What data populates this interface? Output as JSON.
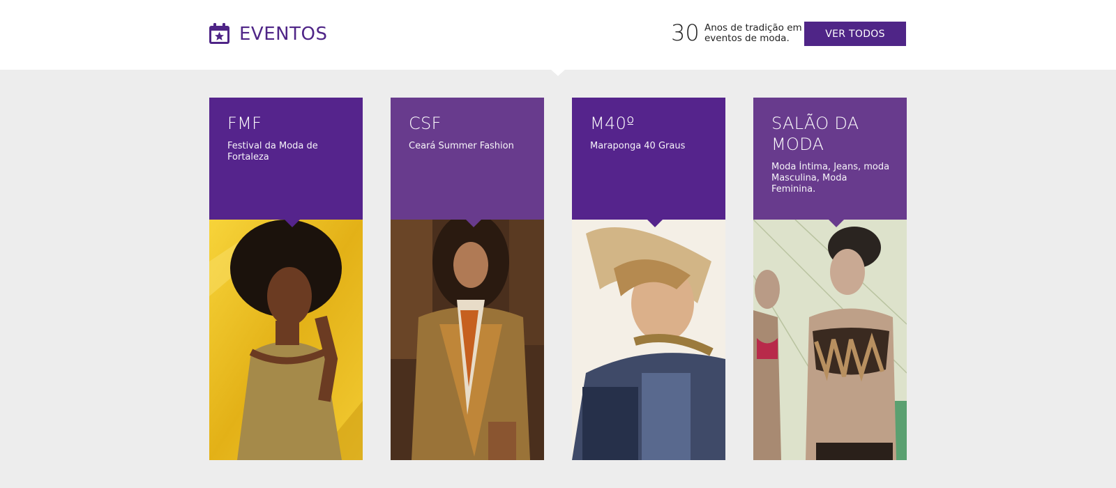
{
  "header": {
    "title": "EVENTOS",
    "icon": "calendar-star-icon",
    "stat_number": "30",
    "stat_text": "Anos de tradição em eventos de moda.",
    "button_label": "VER TODOS"
  },
  "colors": {
    "brand_purple": "#4f2587",
    "card_purple_light": "#683b8d",
    "page_background": "#ededed"
  },
  "events": [
    {
      "title": "FMF",
      "description": "Festival da Moda de Fortaleza",
      "color": "#55248c",
      "photo": "model-photo-gold-background"
    },
    {
      "title": "CSF",
      "description": "Ceará Summer Fashion",
      "color": "#683b8d",
      "photo": "model-photo-sequin-jacket"
    },
    {
      "title": "M40º",
      "description": "Maraponga 40 Graus",
      "color": "#55248c",
      "photo": "model-photo-sunlit"
    },
    {
      "title": "SALÃO DA MODA",
      "description": "Moda Íntima, Jeans, moda Masculina, Moda Feminina.",
      "color": "#683b8d",
      "photo": "model-photo-lingerie"
    }
  ]
}
